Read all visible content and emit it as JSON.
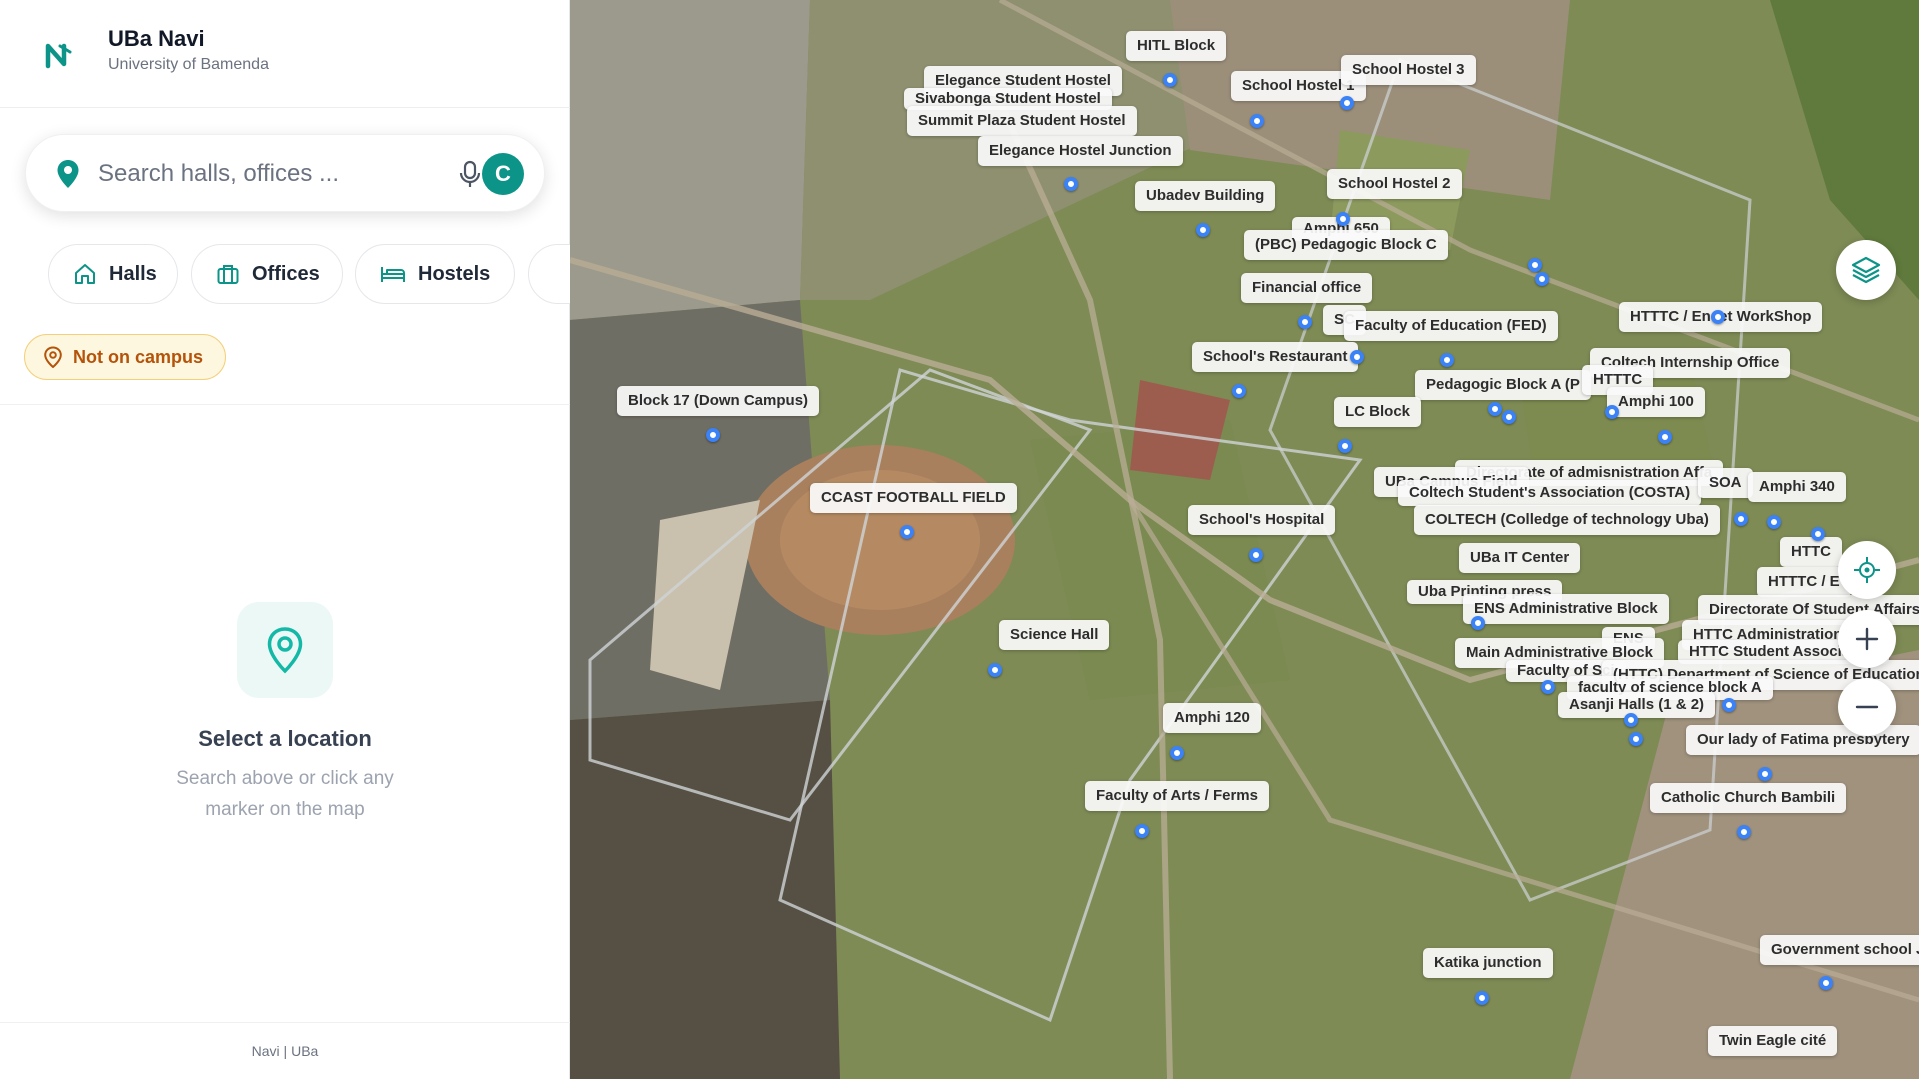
{
  "app": {
    "title": "UBa Navi",
    "subtitle": "University of Bamenda"
  },
  "search": {
    "placeholder": "Search halls, offices ...",
    "avatar_initial": "C"
  },
  "chips": [
    {
      "label": "Halls",
      "icon": "home-icon"
    },
    {
      "label": "Offices",
      "icon": "briefcase-icon"
    },
    {
      "label": "Hostels",
      "icon": "bed-icon"
    }
  ],
  "status": {
    "label": "Not on campus",
    "color": "#b45309"
  },
  "empty_state": {
    "title": "Select a location",
    "text": "Search above or click any marker on the map"
  },
  "footer": {
    "text": "Navi | UBa"
  },
  "colors": {
    "accent": "#0d9488",
    "marker": "#3b82f6"
  },
  "map_labels": [
    "HITL Block",
    "Elegance Student Hostel",
    "Sivabonga Student Hostel",
    "Summit Plaza Student Hostel",
    "Elegance Hostel Junction",
    "School Hostel 1",
    "School Hostel 3",
    "Ubadev Building",
    "School Hostel 2",
    "Amphi 650",
    "(PBC) Pedagogic Block C",
    "Financial office",
    "SC",
    "Faculty of Education (FED)",
    "HTTTC / Enset WorkShop",
    "School's Restaurant",
    "Coltech Internship Office",
    "Pedagogic Block A (P",
    "HTTTC",
    "Block 17 (Down Campus)",
    "LC Block",
    "Amphi 100",
    "Directorate of admisnistration Affa",
    "UBa Campus Field",
    "Coltech Student's Association (COSTA)",
    "SOA",
    "Amphi 340",
    "CCAST FOOTBALL FIELD",
    "School's Hospital",
    "COLTECH (Colledge of technology Uba)",
    "HTTC",
    "UBa IT Center",
    "HTTTC / E",
    "Uba Printing press",
    "ENS Administrative Block",
    "Directorate Of Student Affairs",
    "Science Hall",
    "ENS",
    "HTTC Administration",
    "Main Administrative Block",
    "HTTC Student Association",
    "Faculty of Sci",
    "(HTTC) Department of Science of Education",
    "faculty of science block A",
    "Asanji Halls (1 & 2)",
    "Amphi 120",
    "Our lady of Fatima presbytery",
    "Faculty of Arts / Ferms",
    "Catholic Church Bambili",
    "Katika junction",
    "Government school J",
    "Twin Eagle cité"
  ]
}
